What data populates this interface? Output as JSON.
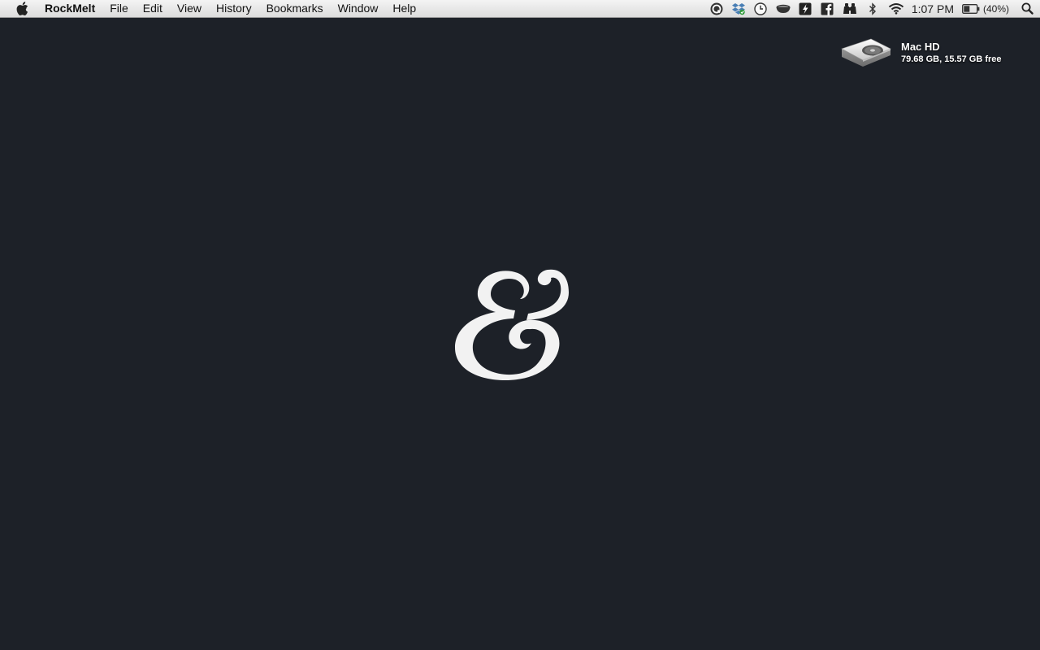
{
  "menubar": {
    "app_name": "RockMelt",
    "menus": [
      "File",
      "Edit",
      "View",
      "History",
      "Bookmarks",
      "Window",
      "Help"
    ],
    "status_icons": [
      "quicksilver-icon",
      "dropbox-icon",
      "time-machine-icon",
      "caffeine-icon",
      "notational-velocity-icon",
      "facebook-icon",
      "binoculars-icon",
      "bluetooth-icon",
      "wifi-icon"
    ],
    "clock": "1:07 PM",
    "battery_percent": "(40%)"
  },
  "desktop": {
    "disk": {
      "name": "Mac HD",
      "info": "79.68 GB, 15.57 GB free"
    }
  },
  "wallpaper": {
    "background_color": "#1d2128",
    "glyph": "&",
    "glyph_color": "#f2f2f2"
  }
}
